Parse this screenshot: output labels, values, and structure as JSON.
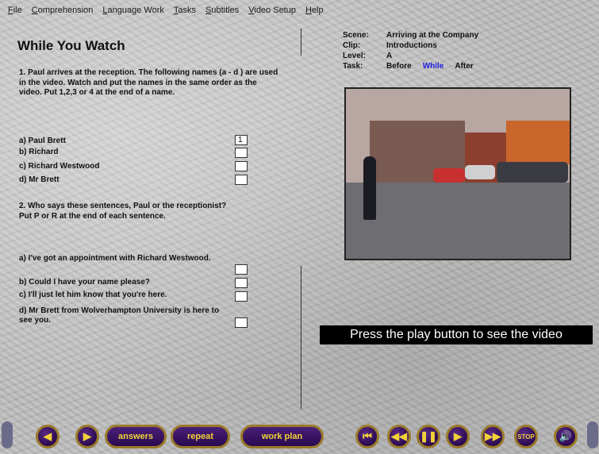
{
  "menu": [
    "File",
    "Comprehension",
    "Language Work",
    "Tasks",
    "Subtitles",
    "Video Setup",
    "Help"
  ],
  "title": "While You Watch",
  "q1": {
    "text": "1. Paul arrives at the reception. The following names (a - d ) are used in the video. Watch and put the names in the same order as the video. Put 1,2,3 or 4 at the end of a name.",
    "items": [
      "a) Paul Brett",
      "b) Richard",
      "c) Richard Westwood",
      "d) Mr Brett"
    ],
    "answers": [
      "1",
      "",
      "",
      ""
    ]
  },
  "q2": {
    "text": "2. Who says these sentences, Paul or the receptionist? Put P or R at the end of each sentence.",
    "items": [
      "a) I've got an appointment with Richard Westwood.",
      "b) Could I have your name please?",
      "c) I'll just let him know that you're here.",
      "d) Mr Brett from Wolverhampton University is here to see you."
    ]
  },
  "info": {
    "scene_label": "Scene:",
    "scene": "Arriving at the Company",
    "clip_label": "Clip:",
    "clip": "Introductions",
    "level_label": "Level:",
    "level": "A",
    "task_label": "Task:",
    "task_before": "Before",
    "task_while": "While",
    "task_after": "After",
    "active_color": "#2020e0"
  },
  "press_message": "Press the play button to see the video",
  "toolbar": {
    "answers": "answers",
    "repeat": "repeat",
    "work_plan": "work plan",
    "stop": "STOP",
    "icons": [
      "arrow-left-icon",
      "arrow-right-icon",
      "skip-start-icon",
      "rewind-icon",
      "pause-icon",
      "play-icon",
      "fast-forward-icon",
      "stop-icon",
      "volume-icon"
    ]
  }
}
